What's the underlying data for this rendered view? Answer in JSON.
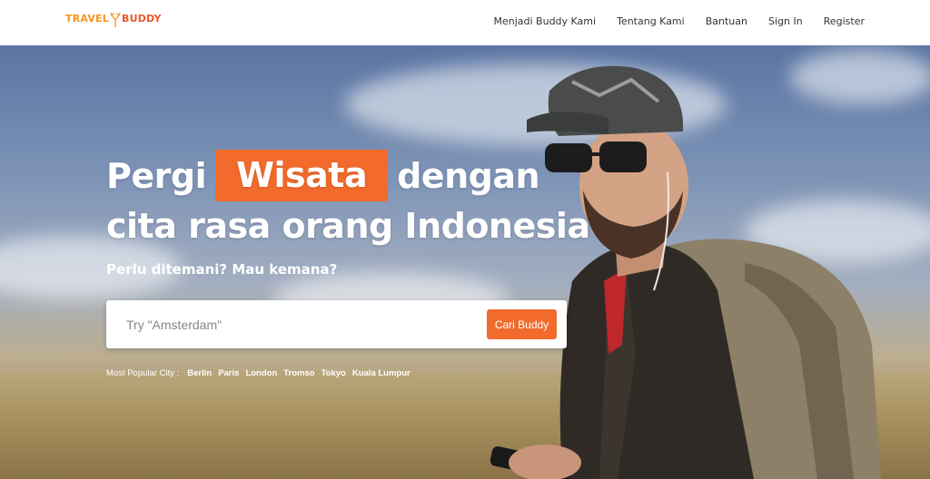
{
  "brand": {
    "part1": "TRAVEL",
    "part2": "BUDDY"
  },
  "nav": {
    "items": [
      {
        "label": "Menjadi Buddy Kami"
      },
      {
        "label": "Tentang Kami"
      },
      {
        "label": "Bantuan"
      },
      {
        "label": "Sign In"
      },
      {
        "label": "Register"
      }
    ]
  },
  "hero": {
    "headline_before": "Pergi",
    "headline_highlight": "Wisata",
    "headline_after": "dengan",
    "headline_line2": "cita rasa orang Indonesia",
    "subheadline": "Perlu ditemani? Mau kemana?"
  },
  "search": {
    "placeholder": "Try \"Amsterdam\"",
    "value": "",
    "button_label": "Cari Buddy"
  },
  "popular": {
    "label": "Most Popular City :",
    "cities": [
      "Berlin",
      "Paris",
      "London",
      "Tromso",
      "Tokyo",
      "Kuala Lumpur"
    ]
  },
  "colors": {
    "accent": "#f26b2d",
    "logo_orange": "#f7941d",
    "nav_text": "#333333"
  }
}
